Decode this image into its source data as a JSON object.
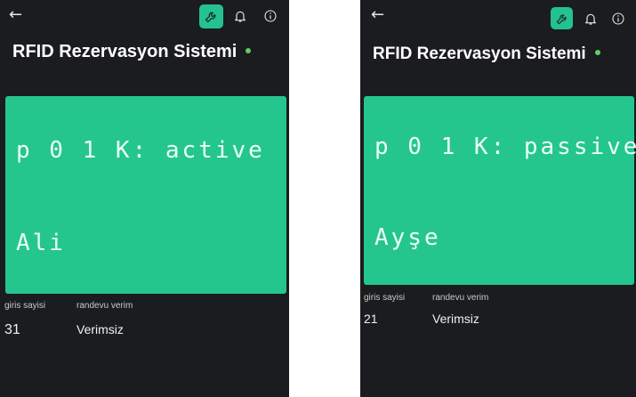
{
  "phones": [
    {
      "title": "RFID Rezervasyon Sistemi",
      "lcd_line1": "p 0 1 K: active",
      "lcd_line2": "Ali",
      "stats": {
        "entries_label": "giris sayisi",
        "entries_value": "31",
        "efficiency_label": "randevu verim",
        "efficiency_value": "Verimsiz"
      }
    },
    {
      "title": "RFID Rezervasyon Sistemi",
      "lcd_line1": "p 0 1 K: passive",
      "lcd_line2": "Ayşe",
      "stats": {
        "entries_label": "giris sayisi",
        "entries_value": "21",
        "efficiency_label": "randevu verim",
        "efficiency_value": "Verimsiz"
      }
    }
  ],
  "icons": {
    "back": "back-arrow-icon",
    "wrench": "wrench-icon",
    "bell": "bell-icon",
    "info": "info-icon",
    "status": "status-dot-icon"
  },
  "colors": {
    "background": "#1b1c1f",
    "accent": "#23c28f",
    "lcd": "#25c68d",
    "status_dot": "#5ecf63"
  }
}
